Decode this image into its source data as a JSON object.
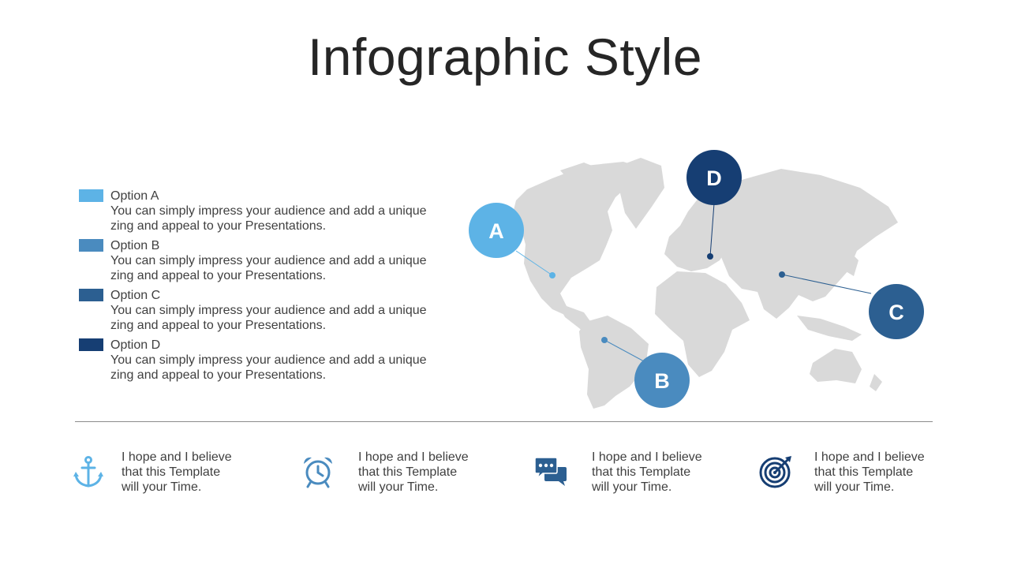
{
  "title": "Infographic Style",
  "colors": {
    "a": "#5DB3E6",
    "b": "#4A8BBF",
    "c": "#2C5F91",
    "d": "#163E73",
    "land": "#D9D9D9"
  },
  "legend": [
    {
      "label": "Option A",
      "desc": "You can simply impress your audience and add a unique zing and appeal to your Presentations."
    },
    {
      "label": "Option B",
      "desc": "You can simply impress your audience and add a unique zing and appeal to your Presentations."
    },
    {
      "label": "Option C",
      "desc": "You can simply impress your audience and add a unique zing and appeal to your Presentations."
    },
    {
      "label": "Option D",
      "desc": "You can simply impress your audience and add a unique zing and appeal to your Presentations."
    }
  ],
  "markers": {
    "a": "A",
    "b": "B",
    "c": "C",
    "d": "D"
  },
  "features": [
    {
      "icon": "anchor-icon",
      "text": "I hope and I believe\nthat this Template\nwill your Time."
    },
    {
      "icon": "alarm-clock-icon",
      "text": "I hope and I believe\nthat this Template\nwill your Time."
    },
    {
      "icon": "chat-bubbles-icon",
      "text": "I hope and I believe\nthat this Template\nwill your Time."
    },
    {
      "icon": "target-icon",
      "text": "I hope and I believe\nthat this Template\nwill your Time."
    }
  ]
}
